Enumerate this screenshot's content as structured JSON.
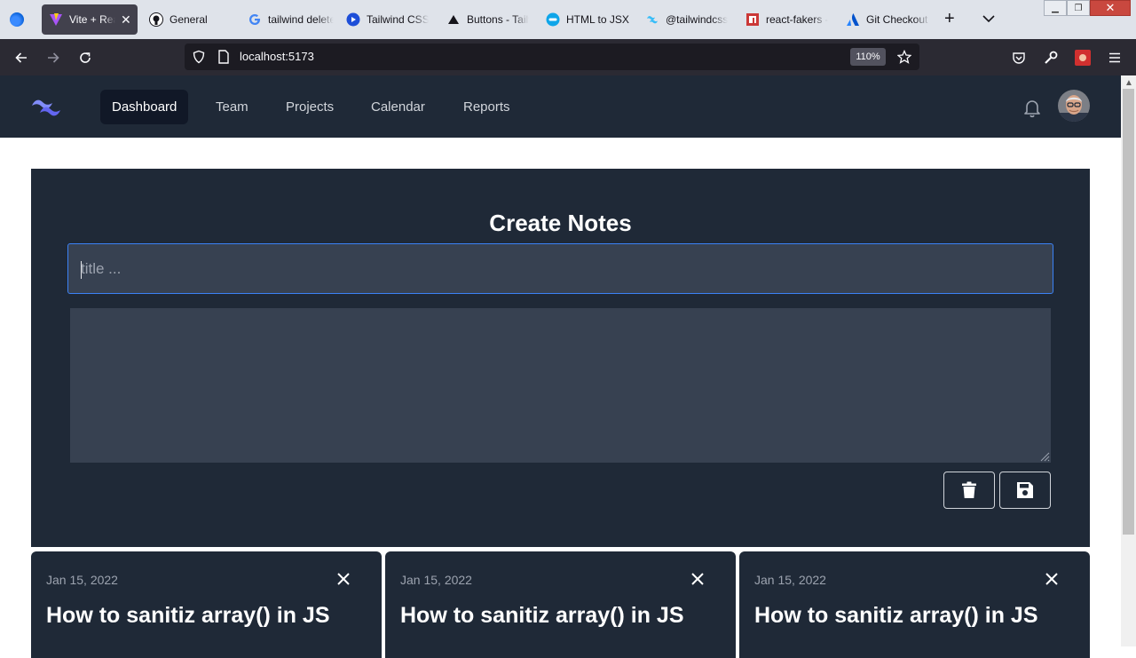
{
  "browser": {
    "tabs": [
      {
        "label": "Vite + React",
        "active": true
      },
      {
        "label": "General"
      },
      {
        "label": "tailwind delete"
      },
      {
        "label": "Tailwind CSS"
      },
      {
        "label": "Buttons - Tailwind"
      },
      {
        "label": "HTML to JSX"
      },
      {
        "label": "@tailwindcss"
      },
      {
        "label": "react-fakers -"
      },
      {
        "label": "Git Checkout"
      }
    ],
    "url": "localhost:5173",
    "zoom": "110%"
  },
  "header": {
    "nav": [
      "Dashboard",
      "Team",
      "Projects",
      "Calendar",
      "Reports"
    ],
    "active_nav": "Dashboard"
  },
  "create_panel": {
    "title": "Create Notes",
    "title_placeholder": "title ...",
    "title_value": "",
    "body_value": ""
  },
  "notes": [
    {
      "date": "Jan 15, 2022",
      "title": "How to sanitiz array() in JS"
    },
    {
      "date": "Jan 15, 2022",
      "title": "How to sanitiz array() in JS"
    },
    {
      "date": "Jan 15, 2022",
      "title": "How to sanitiz array() in JS"
    }
  ],
  "colors": {
    "header_bg": "#1f2937",
    "panel_bg": "#1f2937",
    "input_bg": "#374151",
    "focus_ring": "#3b82f6",
    "active_nav_bg": "#111827"
  }
}
